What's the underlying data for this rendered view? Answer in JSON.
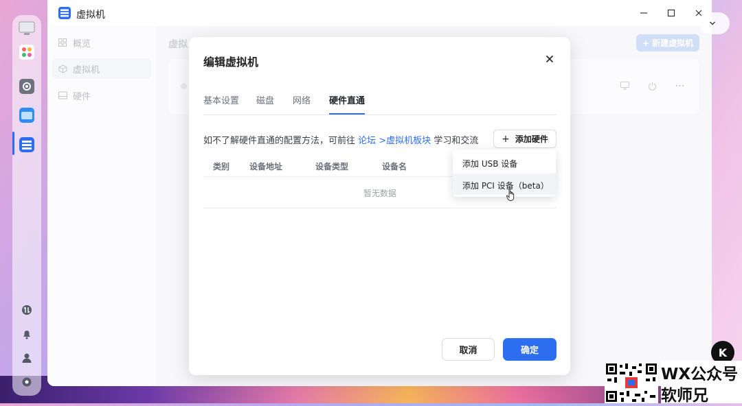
{
  "window": {
    "app_title": "虚拟机"
  },
  "sidebar": {
    "items": [
      {
        "label": "概览",
        "icon": "grid-icon"
      },
      {
        "label": "虚拟机",
        "icon": "cube-icon",
        "active": true
      },
      {
        "label": "硬件",
        "icon": "drive-icon"
      }
    ]
  },
  "content": {
    "title": "虚拟",
    "new_vm_button": "+ 新建虚拟机"
  },
  "dialog": {
    "title": "编辑虚拟机",
    "tabs": [
      {
        "label": "基本设置"
      },
      {
        "label": "磁盘"
      },
      {
        "label": "网络"
      },
      {
        "label": "硬件直通",
        "active": true
      }
    ],
    "info_prefix": "如不了解硬件直通的配置方法，可前往",
    "info_link": "论坛 >虚拟机板块",
    "info_suffix": "学习和交流",
    "add_hardware_button": "添加硬件",
    "table_headers": [
      "类别",
      "设备地址",
      "设备类型",
      "设备名"
    ],
    "empty_text": "暂无数据",
    "dropdown_items": [
      {
        "label": "添加 USB 设备"
      },
      {
        "label": "添加 PCI 设备（beta）",
        "hovered": true
      }
    ],
    "cancel_button": "取消",
    "ok_button": "确定"
  },
  "watermark": {
    "line1": "WX公众号",
    "line2": "软师兄",
    "logo_text": "K"
  },
  "colors": {
    "accent": "#2d6df0",
    "accent_disabled": "#b9cdf4"
  }
}
